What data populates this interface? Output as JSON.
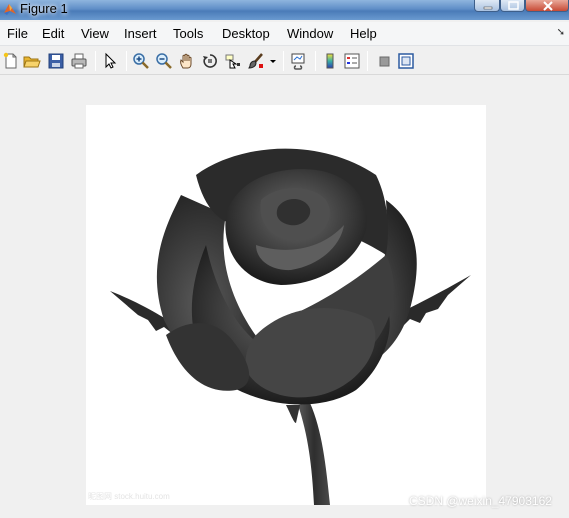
{
  "window": {
    "title": "Figure 1"
  },
  "menu": {
    "items": [
      "File",
      "Edit",
      "View",
      "Insert",
      "Tools",
      "Desktop",
      "Window",
      "Help"
    ]
  },
  "toolbar": {
    "icons": [
      "new-figure-icon",
      "open-file-icon",
      "save-icon",
      "print-icon",
      "select-arrow-icon",
      "zoom-in-icon",
      "zoom-out-icon",
      "pan-hand-icon",
      "rotate-3d-icon",
      "data-cursor-icon",
      "brush-icon",
      "brush-dropdown-icon",
      "link-plot-icon",
      "insert-colorbar-icon",
      "insert-legend-icon",
      "hide-plot-tools-icon",
      "show-plot-tools-icon"
    ]
  },
  "figure": {
    "image_watermark": "昵图网 stock.huitu.com",
    "overlay_watermark": "CSDN @weixin_47903162"
  }
}
